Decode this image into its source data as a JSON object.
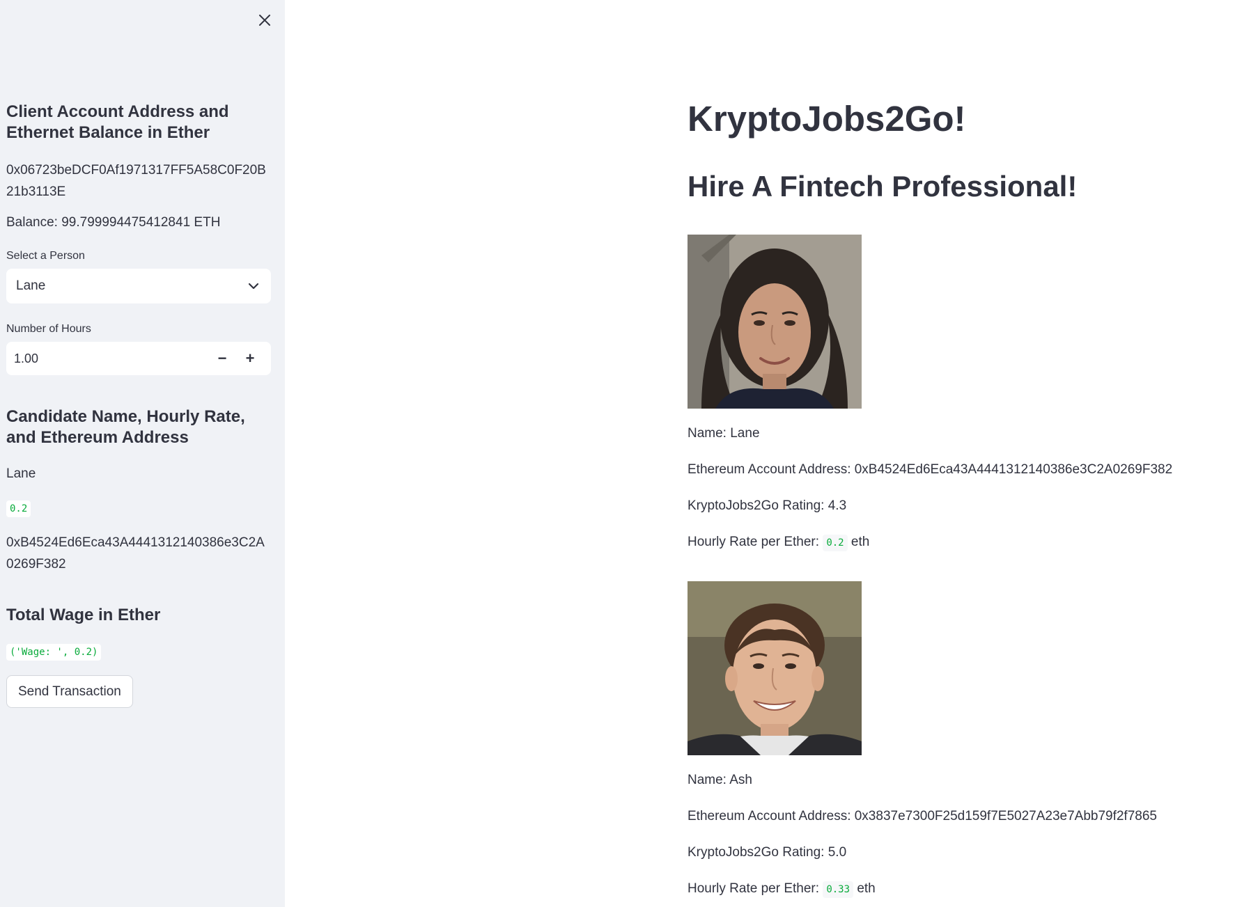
{
  "sidebar": {
    "close_icon": "close-icon",
    "account_heading": "Client Account Address and Ethernet Balance in Ether",
    "account_address": "0x06723beDCF0Af1971317FF5A58C0F20B21b3113E",
    "balance": "Balance: 99.799994475412841 ETH",
    "select_label": "Select a Person",
    "select_value": "Lane",
    "hours_label": "Number of Hours",
    "hours_value": "1.00",
    "minus": "−",
    "plus": "+",
    "candidate_heading": "Candidate Name, Hourly Rate, and Ethereum Address",
    "candidate_name": "Lane",
    "candidate_rate": "0.2",
    "candidate_address": "0xB4524Ed6Eca43A4441312140386e3C2A0269F382",
    "wage_heading": "Total Wage in Ether",
    "wage_value": "('Wage: ', 0.2)",
    "send_button": "Send Transaction"
  },
  "main": {
    "title": "KryptoJobs2Go!",
    "subtitle": "Hire A Fintech Professional!",
    "candidates": [
      {
        "name": "Name: Lane",
        "address": "Ethereum Account Address: 0xB4524Ed6Eca43A4441312140386e3C2A0269F382",
        "rating": "KryptoJobs2Go Rating: 4.3",
        "rate_label": "Hourly Rate per Ether:",
        "rate": "0.2",
        "rate_unit": "eth"
      },
      {
        "name": "Name: Ash",
        "address": "Ethereum Account Address: 0x3837e7300F25d159f7E5027A23e7Abb79f2f7865",
        "rating": "KryptoJobs2Go Rating: 5.0",
        "rate_label": "Hourly Rate per Ether:",
        "rate": "0.33",
        "rate_unit": "eth"
      }
    ]
  },
  "colors": {
    "sidebar_bg": "#f0f2f6",
    "text": "#31333f",
    "code_green": "#09ab3b"
  }
}
